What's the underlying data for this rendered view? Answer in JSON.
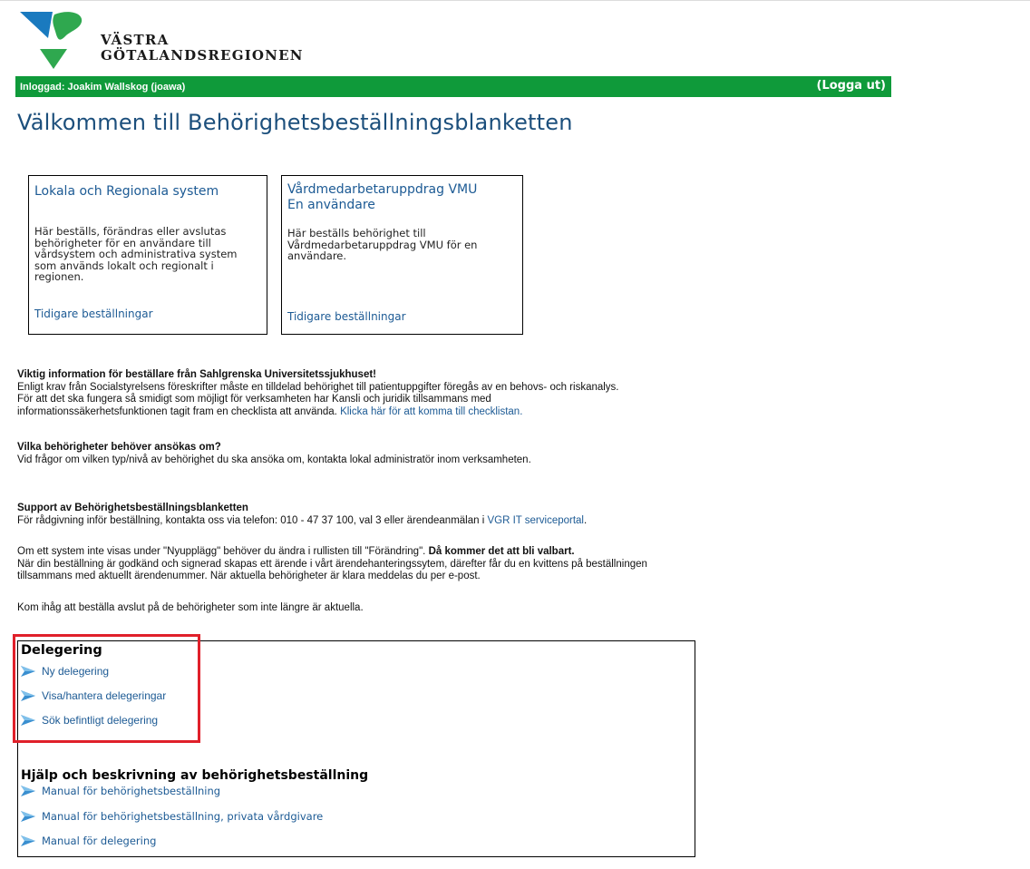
{
  "logo": {
    "line1": "VÄSTRA",
    "line2": "GÖTALANDSREGIONEN"
  },
  "header": {
    "logged_in": "Inloggad: Joakim Wallskog (joawa)",
    "logout": "(Logga ut)"
  },
  "page_title": "Välkommen till Behörighetsbeställningsblanketten",
  "cards": [
    {
      "title_lines": [
        "Lokala och Regionala system"
      ],
      "desc_lines": [
        "Här beställs, förändras eller avslutas",
        "behörigheter för en användare till",
        "vårdsystem och administrativa system",
        "som används lokalt och regionalt i",
        "regionen."
      ],
      "link": "Tidigare beställningar"
    },
    {
      "title_lines": [
        "Vårdmedarbetaruppdrag VMU",
        "En användare"
      ],
      "desc_lines": [
        "Här beställs behörighet till",
        "Vårdmedarbetaruppdrag VMU för en",
        "användare."
      ],
      "link": "Tidigare beställningar"
    }
  ],
  "info": {
    "sahlgrenska_heading": "Viktig information för beställare från Sahlgrenska Universitetssjukhuset!",
    "sahlgrenska_line1": "Enligt krav från Socialstyrelsens föreskrifter måste en tilldelad behörighet till patientuppgifter föregås av en behovs- och riskanalys.",
    "sahlgrenska_line2": "För att det ska fungera så smidigt som möjligt för verksamheten har Kansli och juridik tillsammans med",
    "sahlgrenska_line3": "informationssäkerhetsfunktionen tagit fram en checklista att använda.",
    "sahlgrenska_link": "Klicka här för att komma till checklistan.",
    "which_heading": "Vilka behörigheter behöver ansökas om?",
    "which_text": "Vid frågor om vilken typ/nivå av behörighet du ska ansöka om, kontakta lokal administratör inom verksamheten.",
    "support_heading": "Support av Behörighetsbeställningsblanketten",
    "support_text": "För rådgivning inför beställning, kontakta oss via telefon: 010 - 47 37 100, val 3 eller ärendeanmälan i",
    "support_link": "VGR IT serviceportal",
    "support_end": ".",
    "system_line1a": "Om ett system inte visas under \"Nyupplägg\" behöver du ändra i rullisten till \"Förändring\".",
    "system_line1b": "Då kommer det att bli valbart.",
    "system_line2": "När din beställning är godkänd och signerad skapas ett ärende i vårt ärendehanteringssytem, därefter får du en kvittens på beställningen",
    "system_line3": "tillsammans med aktuellt ärendenummer. När aktuella behörigheter är klara meddelas du per e-post.",
    "remember": "Kom ihåg att beställa avslut på de behörigheter som inte längre är aktuella."
  },
  "delegering": {
    "heading": "Delegering",
    "items": [
      "Ny delegering",
      "Visa/hantera delegeringar",
      "Sök befintligt delegering"
    ]
  },
  "help": {
    "heading": "Hjälp och beskrivning av behörighetsbeställning",
    "items": [
      "Manual för behörighetsbeställning",
      "Manual för behörighetsbeställning, privata vårdgivare",
      "Manual för delegering"
    ]
  },
  "colors": {
    "green_bar": "#0f9a3a",
    "link": "#1c5a94",
    "title": "#1c4f7c",
    "highlight": "#e0202a",
    "logo_blue": "#1a7abf",
    "logo_green": "#2fa84f"
  }
}
